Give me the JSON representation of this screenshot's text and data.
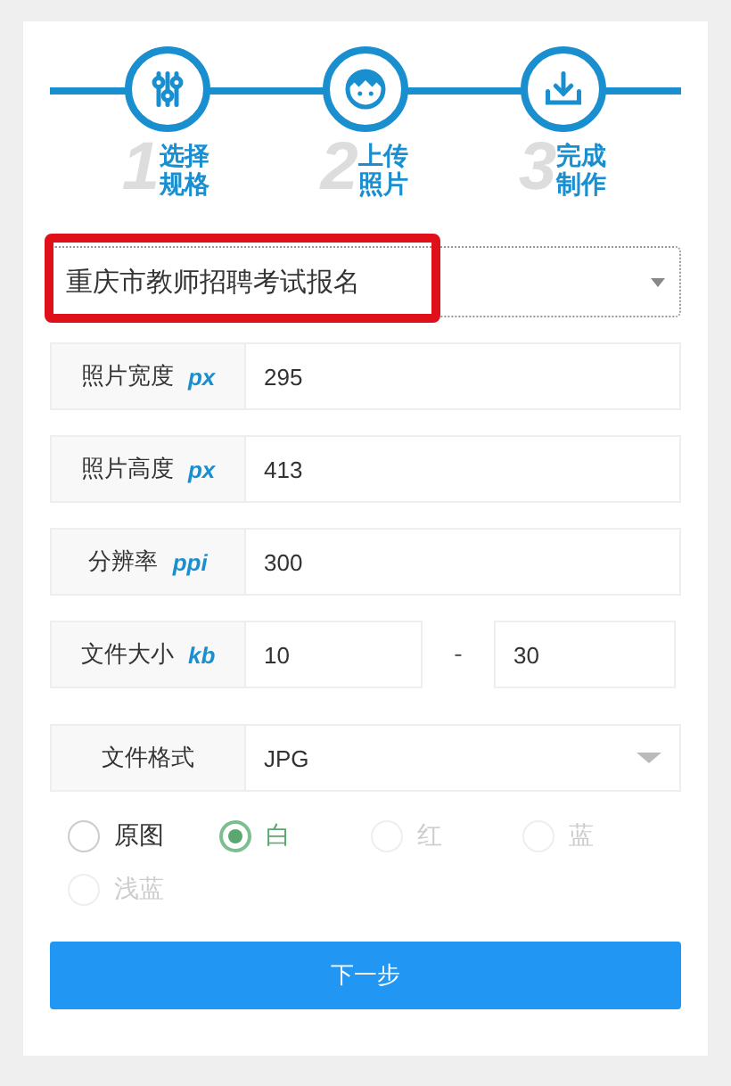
{
  "steps": [
    {
      "number": "1",
      "label": "选择规格",
      "kind": "sliders"
    },
    {
      "number": "2",
      "label": "上传照片",
      "kind": "face"
    },
    {
      "number": "3",
      "label": "完成制作",
      "kind": "download"
    }
  ],
  "template_select": {
    "value": "重庆市教师招聘考试报名",
    "highlighted": true
  },
  "fields": [
    {
      "kind": "single",
      "label": "照片宽度",
      "unit": "px",
      "value": "295"
    },
    {
      "kind": "single",
      "label": "照片高度",
      "unit": "px",
      "value": "413"
    },
    {
      "kind": "single",
      "label": "分辨率",
      "unit": "ppi",
      "value": "300"
    },
    {
      "kind": "range",
      "label": "文件大小",
      "unit": "kb",
      "value": "10",
      "separator": "-",
      "value_2": "30"
    },
    {
      "kind": "select",
      "label": "文件格式",
      "value": "JPG"
    }
  ],
  "backgrounds": [
    {
      "label": "原图",
      "selected": false,
      "disabled": false
    },
    {
      "label": "白",
      "selected": true,
      "disabled": false
    },
    {
      "label": "红",
      "selected": false,
      "disabled": true
    },
    {
      "label": "蓝",
      "selected": false,
      "disabled": true
    },
    {
      "label": "浅蓝",
      "selected": false,
      "disabled": true
    }
  ],
  "next_button": "下一步"
}
